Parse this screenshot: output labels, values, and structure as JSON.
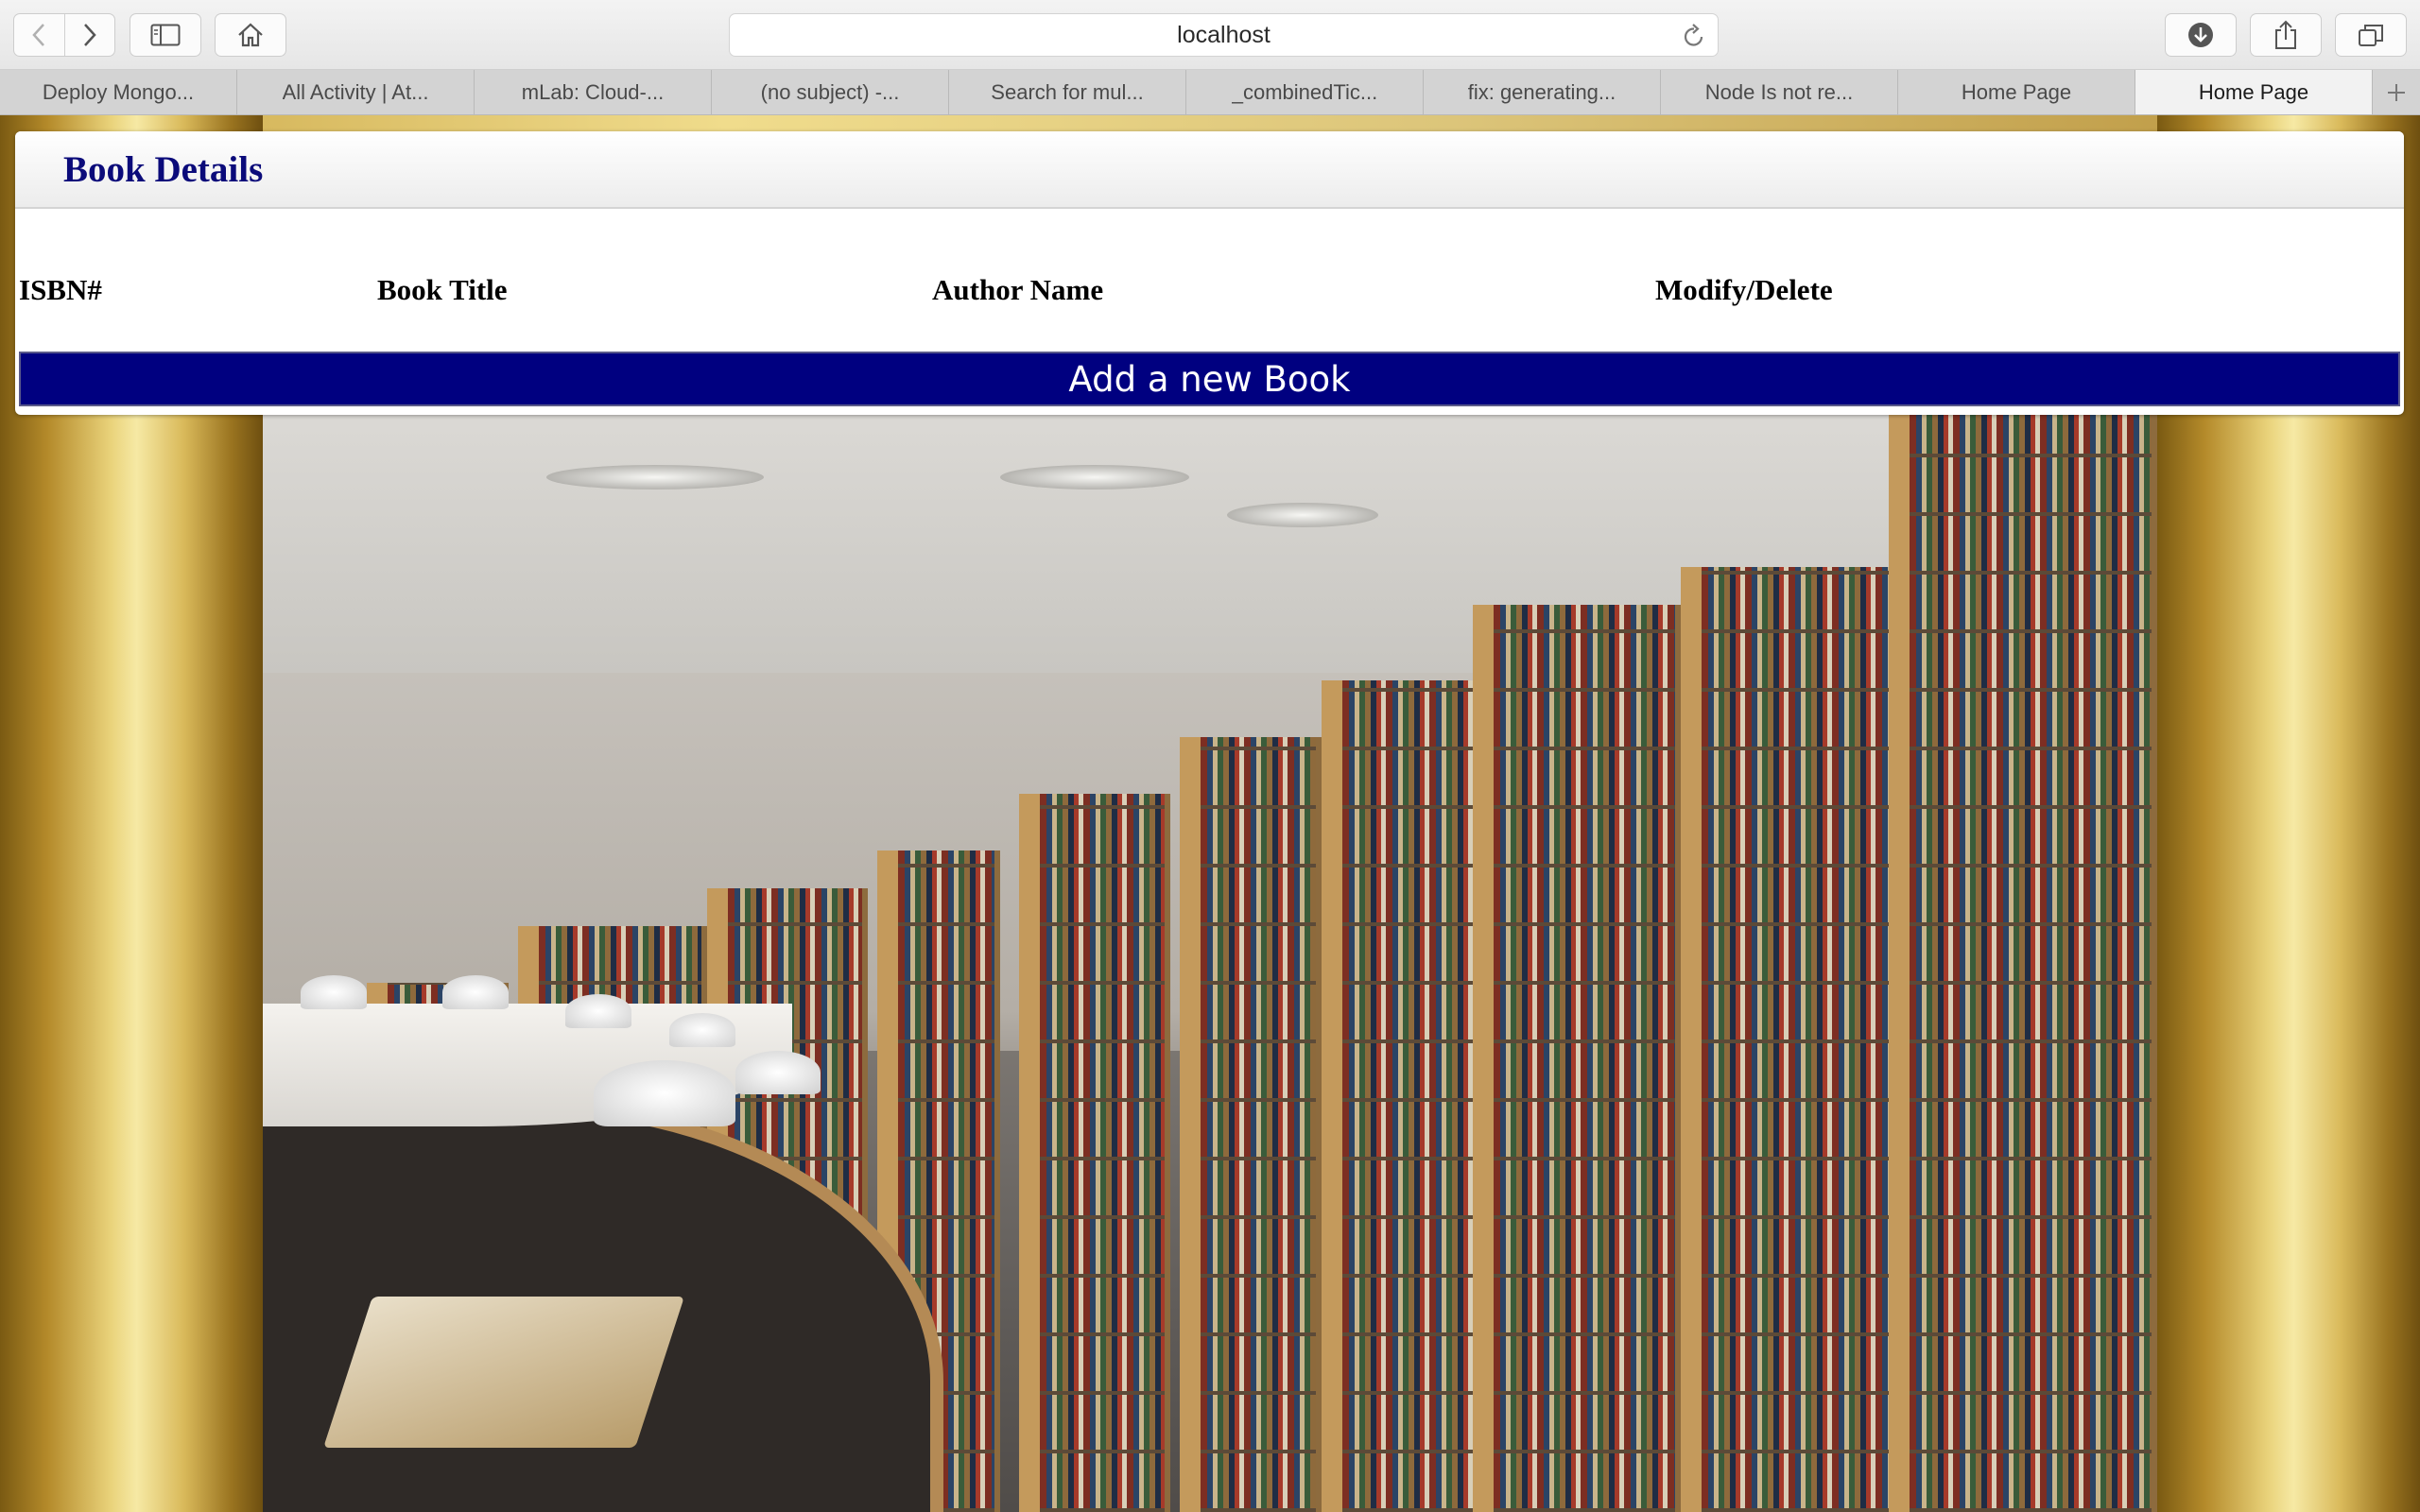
{
  "browser": {
    "address": "localhost",
    "tabs": [
      {
        "label": "Deploy Mongo..."
      },
      {
        "label": "All Activity | At..."
      },
      {
        "label": "mLab: Cloud-..."
      },
      {
        "label": "(no subject) -..."
      },
      {
        "label": "Search for mul..."
      },
      {
        "label": "_combinedTic..."
      },
      {
        "label": "fix: generating..."
      },
      {
        "label": "Node Is not re..."
      },
      {
        "label": "Home Page"
      },
      {
        "label": "Home Page"
      }
    ],
    "active_tab_index": 9,
    "icons": [
      "back-icon",
      "forward-icon",
      "sidebar-icon",
      "home-icon",
      "reload-icon",
      "download-icon",
      "share-icon",
      "tabs-overview-icon",
      "new-tab-icon"
    ]
  },
  "page": {
    "title": "Book Details",
    "table": {
      "headers": [
        "ISBN#",
        "Book Title",
        "Author Name",
        "Modify/Delete"
      ],
      "rows": []
    },
    "add_button_label": "Add a new Book"
  },
  "colors": {
    "title": "#0b0b7a",
    "add_button_bg": "#000080",
    "add_button_text": "#ffffff"
  }
}
